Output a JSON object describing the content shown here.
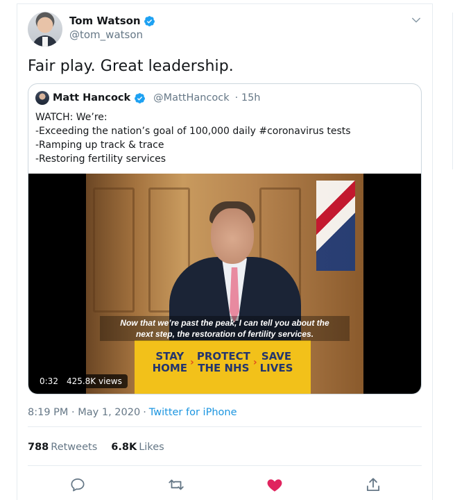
{
  "tweet": {
    "author_name": "Tom Watson",
    "author_handle": "@tom_watson",
    "text": "Fair play. Great leadership.",
    "timestamp": "8:19 PM · May 1, 2020",
    "separator": "·",
    "source": "Twitter for iPhone",
    "retweets_count": "788",
    "retweets_label": "Retweets",
    "likes_count": "6.8K",
    "likes_label": "Likes",
    "liked": true,
    "like_color": "#e0245e",
    "accent_color": "#1da1f2"
  },
  "quote": {
    "author_name": "Matt Hancock",
    "author_handle": "@MattHancock",
    "age": "· 15h",
    "lines": [
      "WATCH: We’re:",
      "-Exceeding the nation’s goal of 100,000 daily #coronavirus tests",
      "-Ramping up track & trace",
      "-Restoring fertility services"
    ],
    "video": {
      "duration": "0:32",
      "views": "425.8K views",
      "caption_line1": "Now that we’re past the peak, I can tell you about the",
      "caption_line2": "next step, the restoration of fertility services.",
      "podium": [
        "STAY",
        "HOME",
        "PROTECT",
        "THE NHS",
        "SAVE",
        "LIVES"
      ]
    }
  },
  "icons": [
    "verified-badge-icon",
    "chevron-down-icon",
    "reply-icon",
    "retweet-icon",
    "like-icon",
    "share-icon"
  ]
}
